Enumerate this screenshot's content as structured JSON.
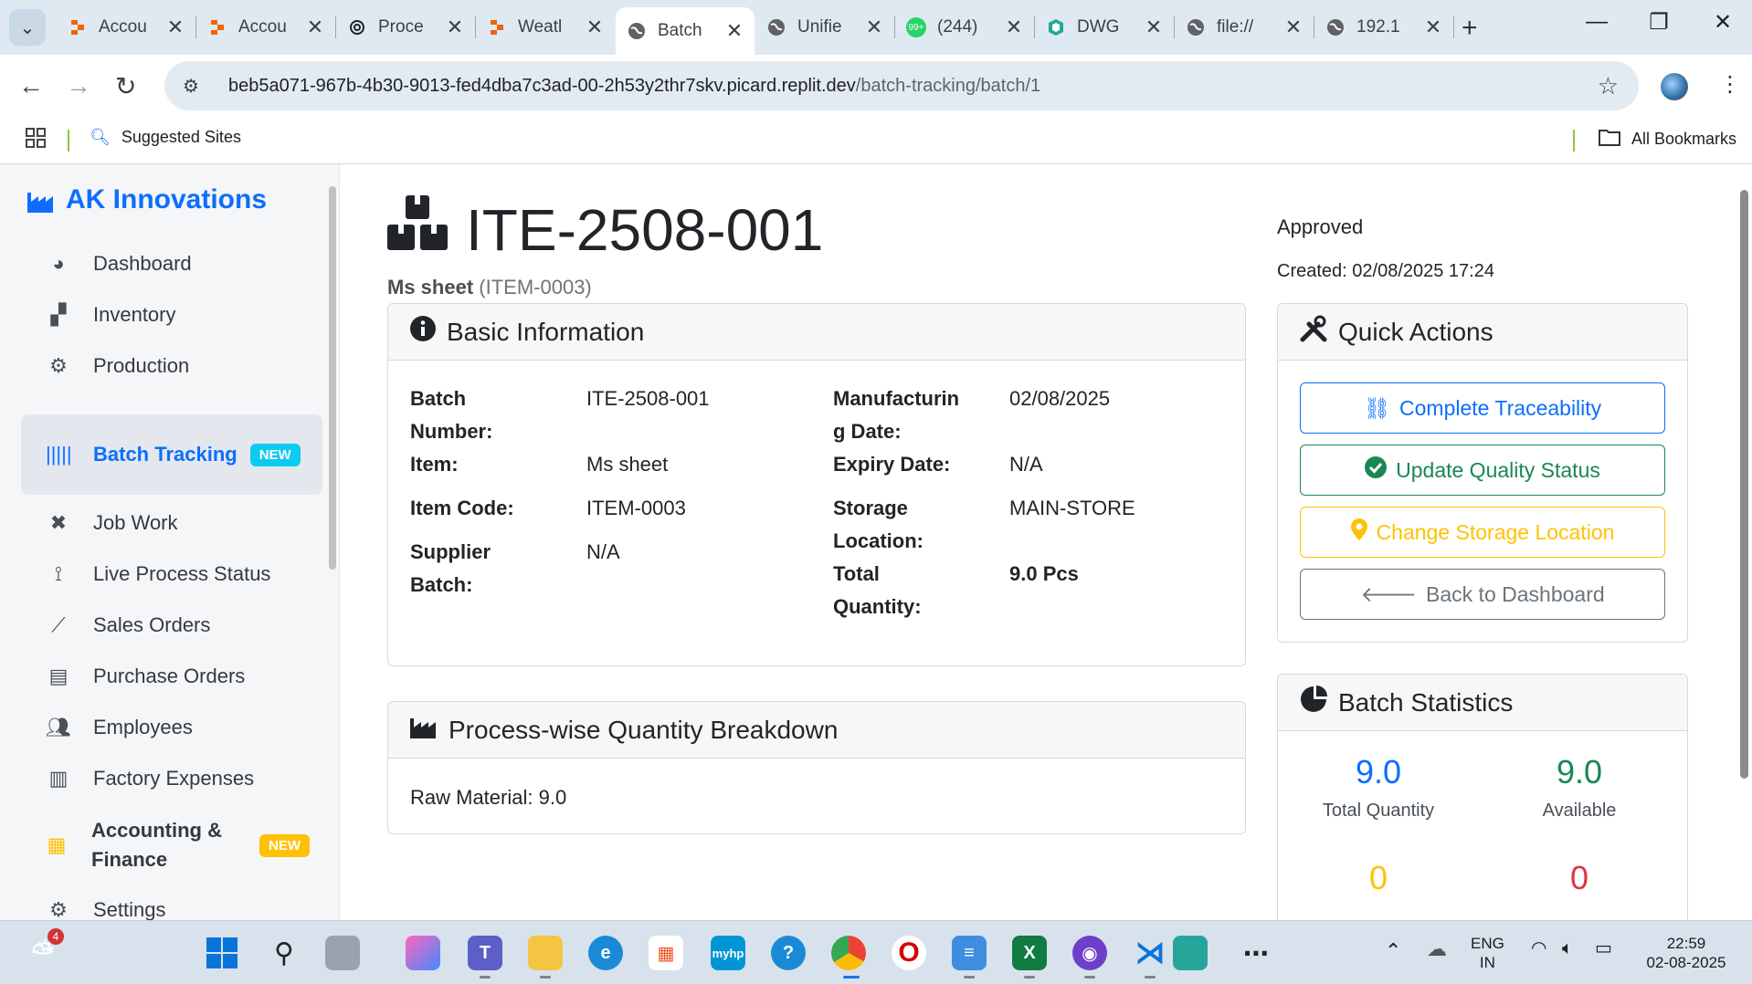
{
  "browser": {
    "tabs": [
      {
        "title": "Accou",
        "icon": "replit-icon"
      },
      {
        "title": "Accou",
        "icon": "replit-icon"
      },
      {
        "title": "Proce",
        "icon": "openai-icon"
      },
      {
        "title": "Weatl",
        "icon": "replit-icon"
      },
      {
        "title": "Batch",
        "icon": "globe-icon",
        "active": true
      },
      {
        "title": "Unifie",
        "icon": "globe-icon"
      },
      {
        "title": "(244)",
        "icon": "whatsapp-icon"
      },
      {
        "title": "DWG",
        "icon": "dwg-icon"
      },
      {
        "title": "file://",
        "icon": "globe-icon"
      },
      {
        "title": "192.1",
        "icon": "globe-icon"
      }
    ],
    "close_glyph": "✕",
    "url_host": "beb5a071-967b-4b30-9013-fed4dba7c3ad-00-2h53y2thr7skv.picard.replit.dev",
    "url_path": "/batch-tracking/batch/1",
    "bookmarks": {
      "suggested": "Suggested Sites",
      "all": "All Bookmarks"
    }
  },
  "sidebar": {
    "brand": "AK Innovations",
    "items": [
      {
        "label": "Dashboard",
        "icon": "palette-icon"
      },
      {
        "label": "Inventory",
        "icon": "boxes-icon"
      },
      {
        "label": "Production",
        "icon": "gears-icon"
      },
      {
        "label": "Batch Tracking",
        "icon": "barcode-icon",
        "badge": "NEW",
        "active": true
      },
      {
        "label": "Job Work",
        "icon": "tools-icon"
      },
      {
        "label": "Live Process Status",
        "icon": "antenna-icon"
      },
      {
        "label": "Sales Orders",
        "icon": "chart-line-icon"
      },
      {
        "label": "Purchase Orders",
        "icon": "file-invoice-icon"
      },
      {
        "label": "Employees",
        "icon": "users-icon"
      },
      {
        "label": "Factory Expenses",
        "icon": "receipt-icon"
      },
      {
        "label": "Accounting & Finance",
        "icon": "calculator-icon",
        "badge": "NEW"
      },
      {
        "label": "Settings",
        "icon": "gear-icon"
      }
    ]
  },
  "header": {
    "batch_number": "ITE-2508-001",
    "item_name": "Ms sheet",
    "item_code_paren": "(ITEM-0003)",
    "status": "Approved",
    "created": "Created: 02/08/2025 17:24"
  },
  "basic_info": {
    "title": "Basic Information",
    "left": [
      {
        "label_lines": [
          "Batch",
          "Number:"
        ],
        "value": "ITE-2508-001"
      },
      {
        "label_lines": [
          "Item:"
        ],
        "value": "Ms sheet"
      },
      {
        "label_lines": [
          "Item Code:"
        ],
        "value": "ITEM-0003"
      },
      {
        "label_lines": [
          "Supplier",
          "Batch:"
        ],
        "value": "N/A"
      }
    ],
    "right": [
      {
        "label_lines": [
          "Manufacturin",
          "g Date:"
        ],
        "value": "02/08/2025"
      },
      {
        "label_lines": [
          "Expiry Date:"
        ],
        "value": "N/A"
      },
      {
        "label_lines": [
          "Storage",
          "Location:"
        ],
        "value": "MAIN-STORE"
      },
      {
        "label_lines": [
          "Total",
          "Quantity:"
        ],
        "value": "9.0 Pcs"
      }
    ]
  },
  "breakdown": {
    "title": "Process-wise Quantity Breakdown",
    "line": "Raw Material: 9.0"
  },
  "quick_actions": {
    "title": "Quick Actions",
    "buttons": [
      {
        "label": "Complete Traceability",
        "icon": "route-icon",
        "style": "blue"
      },
      {
        "label": "Update Quality Status",
        "icon": "check-circle-icon",
        "style": "green"
      },
      {
        "label": "Change Storage Location",
        "icon": "map-marker-icon",
        "style": "yellow"
      },
      {
        "label": "Back to Dashboard",
        "icon": "arrow-left-icon",
        "style": "gray"
      }
    ]
  },
  "batch_statistics": {
    "title": "Batch Statistics",
    "stats": [
      {
        "value": "9.0",
        "caption": "Total Quantity",
        "color": "#0d6efd"
      },
      {
        "value": "9.0",
        "caption": "Available",
        "color": "#198754"
      },
      {
        "value": "0",
        "caption": "",
        "color": "#ffc107"
      },
      {
        "value": "0",
        "caption": "",
        "color": "#dc3545"
      }
    ]
  },
  "taskbar": {
    "weather_badge": "4",
    "lang_line1": "ENG",
    "lang_line2": "IN",
    "time": "22:59",
    "date": "02-08-2025"
  }
}
